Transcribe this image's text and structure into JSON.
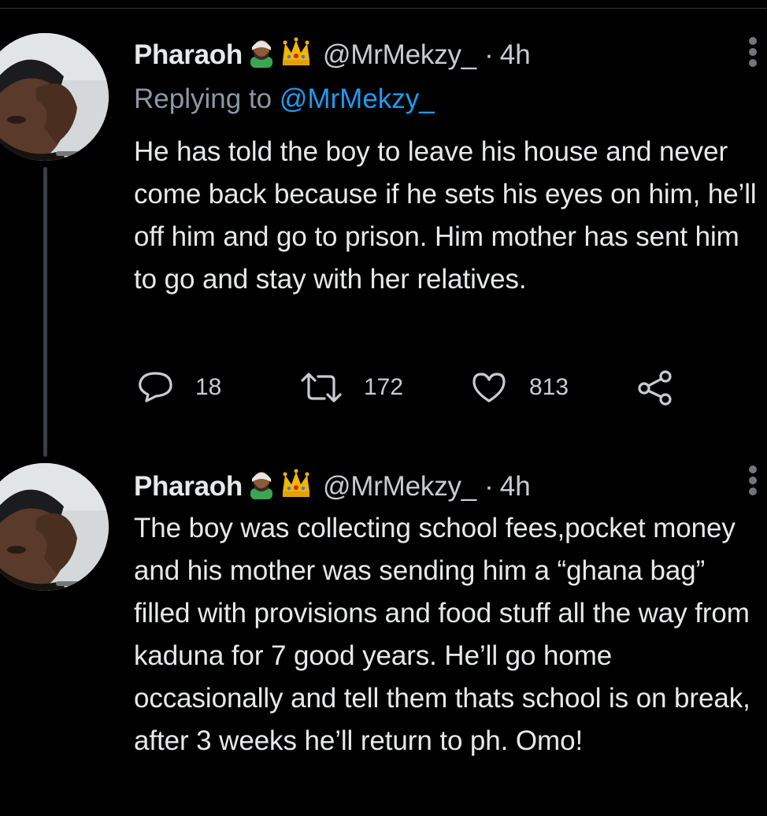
{
  "tweets": [
    {
      "author_name": "Pharaoh",
      "handle": "@MrMekzy_",
      "separator": "·",
      "time": "4h",
      "replying_prefix": "Replying to ",
      "replying_to": "@MrMekzy_",
      "text": "He has told the boy to leave his house and never come back because if he sets his eyes on him, he’ll off him and go to prison. Him mother has sent him to go and stay with her relatives.",
      "replies": "18",
      "retweets": "172",
      "likes": "813"
    },
    {
      "author_name": "Pharaoh",
      "handle": "@MrMekzy_",
      "separator": "·",
      "time": "4h",
      "text": "The boy was collecting school fees,pocket money and his mother was sending him a “ghana bag” filled with provisions and food stuff all the way from kaduna for 7 good years. He’ll go home occasionally and tell them thats school is on break, after 3 weeks he’ll return to ph. Omo!"
    }
  ],
  "icons": {
    "name_emojis": [
      "person-with-headwrap-emoji",
      "crown-emoji"
    ],
    "actions": [
      "reply-icon",
      "retweet-icon",
      "like-icon",
      "share-icon"
    ],
    "menu": "more-options-icon"
  },
  "colors": {
    "background": "#000000",
    "text_primary": "#e7e9ea",
    "text_secondary": "#8b98a5",
    "link": "#1d9bf0",
    "thread_line": "#3a3f44"
  }
}
